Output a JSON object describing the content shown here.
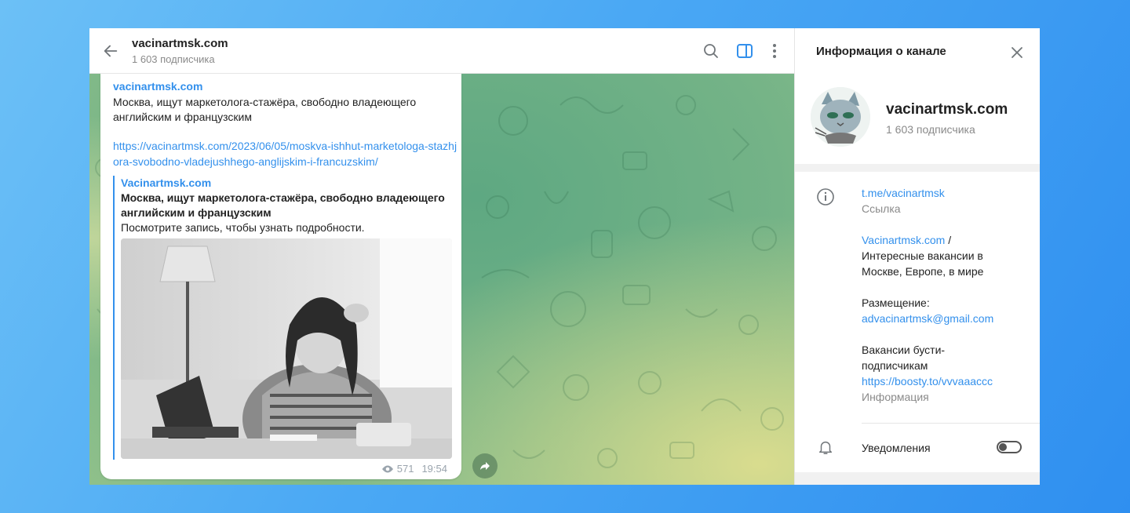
{
  "chat_header": {
    "title": "vacinartmsk.com",
    "subscribers": "1 603 подписчика",
    "icons": [
      "back-arrow-icon",
      "search-icon",
      "sidebar-toggle-icon",
      "more-vertical-icon"
    ]
  },
  "message": {
    "sender": "vacinartmsk.com",
    "text": "Москва, ищут маркетолога-стажёра, свободно владеющего английским и французским",
    "link": "https://vacinartmsk.com/2023/06/05/moskva-ishhut-marketologa-stazhjora-svobodno-vladejushhego-anglijskim-i-francuzskim/",
    "preview": {
      "site": "Vacinartmsk.com",
      "title": "Москва, ищут маркетолога-стажёра, свободно владеющего английским и французским",
      "description": "Посмотрите запись, чтобы узнать подробности."
    },
    "views": "571",
    "time": "19:54"
  },
  "info_panel": {
    "title": "Информация о канале",
    "name": "vacinartmsk.com",
    "subscribers": "1 603 подписчика",
    "link": "t.me/vacinartmsk",
    "link_caption": "Ссылка",
    "about_site": "Vacinartmsk.com",
    "about_sep": " /",
    "about_text": "Интересные вакансии в Москве, Европе, в мире",
    "placement_label": "Размещение:",
    "placement_email": "advacinartmsk@gmail.com",
    "boost_text": "Вакансии бусти-подписчикам",
    "boost_link": "https://boosty.to/vvvaaaccc",
    "info_caption": "Информация",
    "notifications_label": "Уведомления",
    "notifications_on": false
  },
  "colors": {
    "accent": "#3390ec",
    "background_gradient_start": "#6cc0f6",
    "background_gradient_end": "#2f8ff0"
  }
}
